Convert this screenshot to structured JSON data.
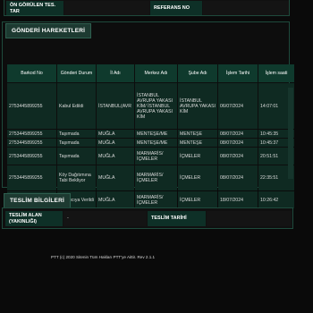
{
  "top_fragment": {
    "label_left": "ÖN GÖRÜLEN TES. TAR",
    "label_right": "REFERANS NO"
  },
  "movements": {
    "title": "GÖNDERİ HAREKETLERİ",
    "columns": [
      "Barkod No",
      "Gönderi Durum",
      "İl Adı",
      "Merkez Adı",
      "Şube Adı",
      "İşlem Tarihi",
      "İşlem saati"
    ],
    "rows": [
      {
        "barcode": "2753445899255",
        "status": "Kabul Edildi",
        "city": "İSTANBUL(AVR",
        "center": "İSTANBUL AVRUPA YAKASI KİM/ İSTANBUL AVRUPA YAKASI KİM",
        "branch": "İSTANBUL AVRUPA YAKASI KİM",
        "date": "06/07/2024",
        "time": "14:07:01"
      },
      {
        "barcode": "2753445899255",
        "status": "Taşımada",
        "city": "MUĞLA",
        "center": "MENTEŞE/ME",
        "branch": "MENTEŞE",
        "date": "08/07/2024",
        "time": "10:45:35"
      },
      {
        "barcode": "2753445899255",
        "status": "Taşımada",
        "city": "MUĞLA",
        "center": "MENTEŞE/ME",
        "branch": "MENTEŞE",
        "date": "08/07/2024",
        "time": "10:45:37"
      },
      {
        "barcode": "2753445899255",
        "status": "Taşımada",
        "city": "MUĞLA",
        "center": "MARMARİS/ İÇMELER",
        "branch": "İÇMELER",
        "date": "08/07/2024",
        "time": "20:51:51"
      },
      {
        "barcode": "2753445899255",
        "status": "Köy Dağıtımına Tabi Bekliyor",
        "city": "MUĞLA",
        "center": "MARMARİS/ İÇMELER",
        "branch": "İÇMELER",
        "date": "08/07/2024",
        "time": "22:35:51"
      },
      {
        "barcode": "2753445899255",
        "status": "Dağıtıcıya Verildi",
        "city": "MUĞLA",
        "center": "MARMARİS/ İÇMELER",
        "branch": "İÇMELER",
        "date": "18/07/2024",
        "time": "10:26:42"
      }
    ]
  },
  "delivery": {
    "title": "TESLİM BİLGİLERİ",
    "receiver_label": "TESLİM ALAN (YAKINLIĞI)",
    "receiver_value": "-",
    "date_label": "TESLİM TARİHİ",
    "date_value": ""
  },
  "footer": {
    "text": "PTT (c) 2020 Sitenin Tüm Hakları PTT'ye Aittir. Rev 2.1.1"
  },
  "colors": {
    "background": "#0a0a0a",
    "header_green": "#0f3a2d",
    "row_green": "#0f2a22",
    "title_green": "#1d3a31"
  }
}
